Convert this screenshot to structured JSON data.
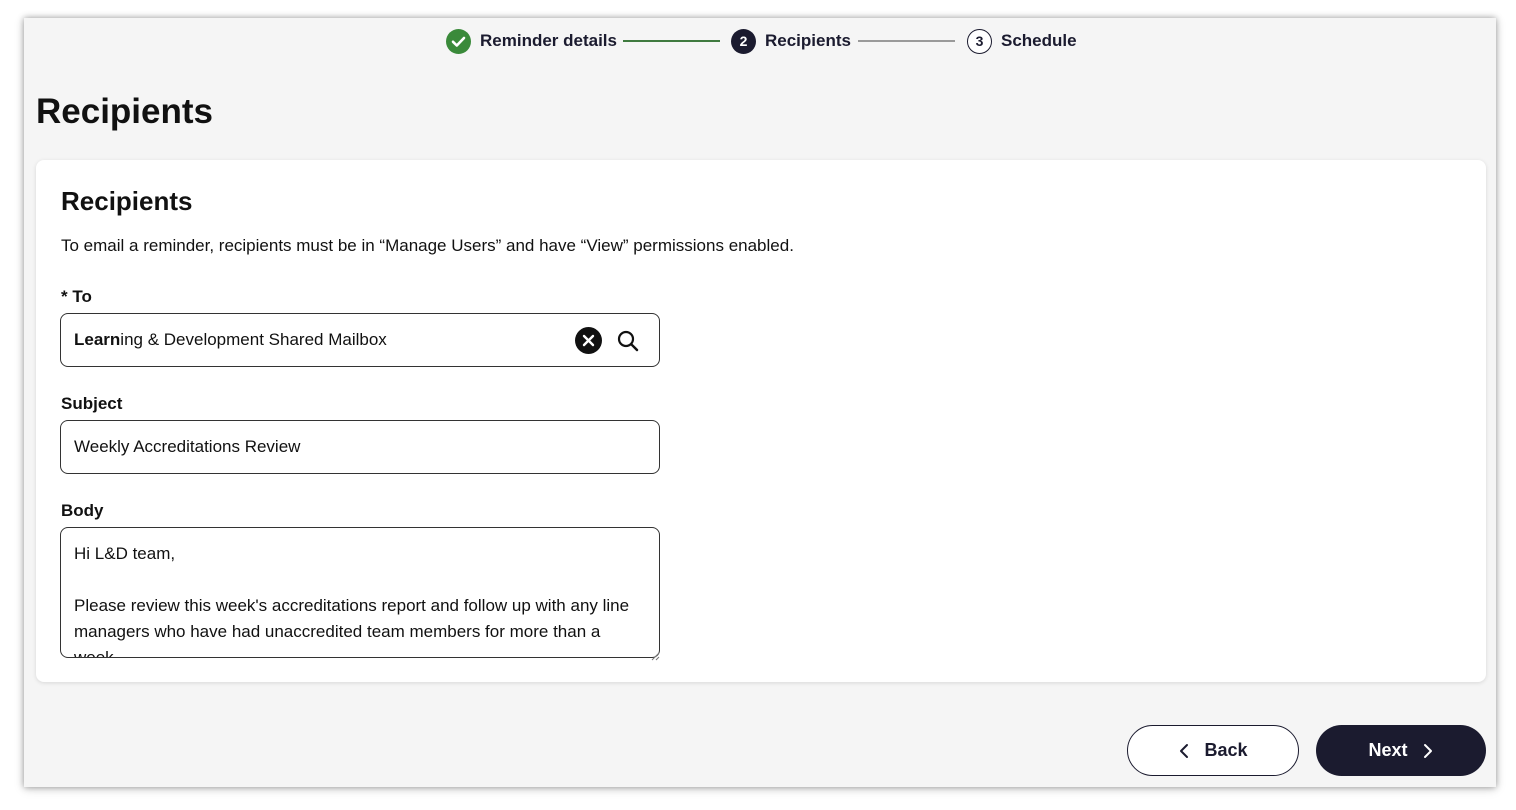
{
  "stepper": {
    "steps": [
      {
        "label": "Reminder details",
        "state": "done",
        "number": ""
      },
      {
        "label": "Recipients",
        "state": "current",
        "number": "2"
      },
      {
        "label": "Schedule",
        "state": "todo",
        "number": "3"
      }
    ]
  },
  "page": {
    "title": "Recipients"
  },
  "card": {
    "title": "Recipients",
    "description": "To email a reminder, recipients must be in “Manage Users” and have “View” permissions enabled."
  },
  "form": {
    "to": {
      "label": "* To",
      "value_match": "Learn",
      "value_rest": "ing & Development Shared Mailbox"
    },
    "subject": {
      "label": "Subject",
      "value": "Weekly Accreditations Review"
    },
    "body": {
      "label": "Body",
      "value": "Hi L&D team,\n\nPlease review this week's accreditations report and follow up with any line managers who have had unaccredited team members for more than a week."
    }
  },
  "actions": {
    "back_label": "Back",
    "next_label": "Next"
  },
  "colors": {
    "primary": "#1b1b2f",
    "success": "#3a8a3a",
    "background": "#f5f5f5"
  }
}
